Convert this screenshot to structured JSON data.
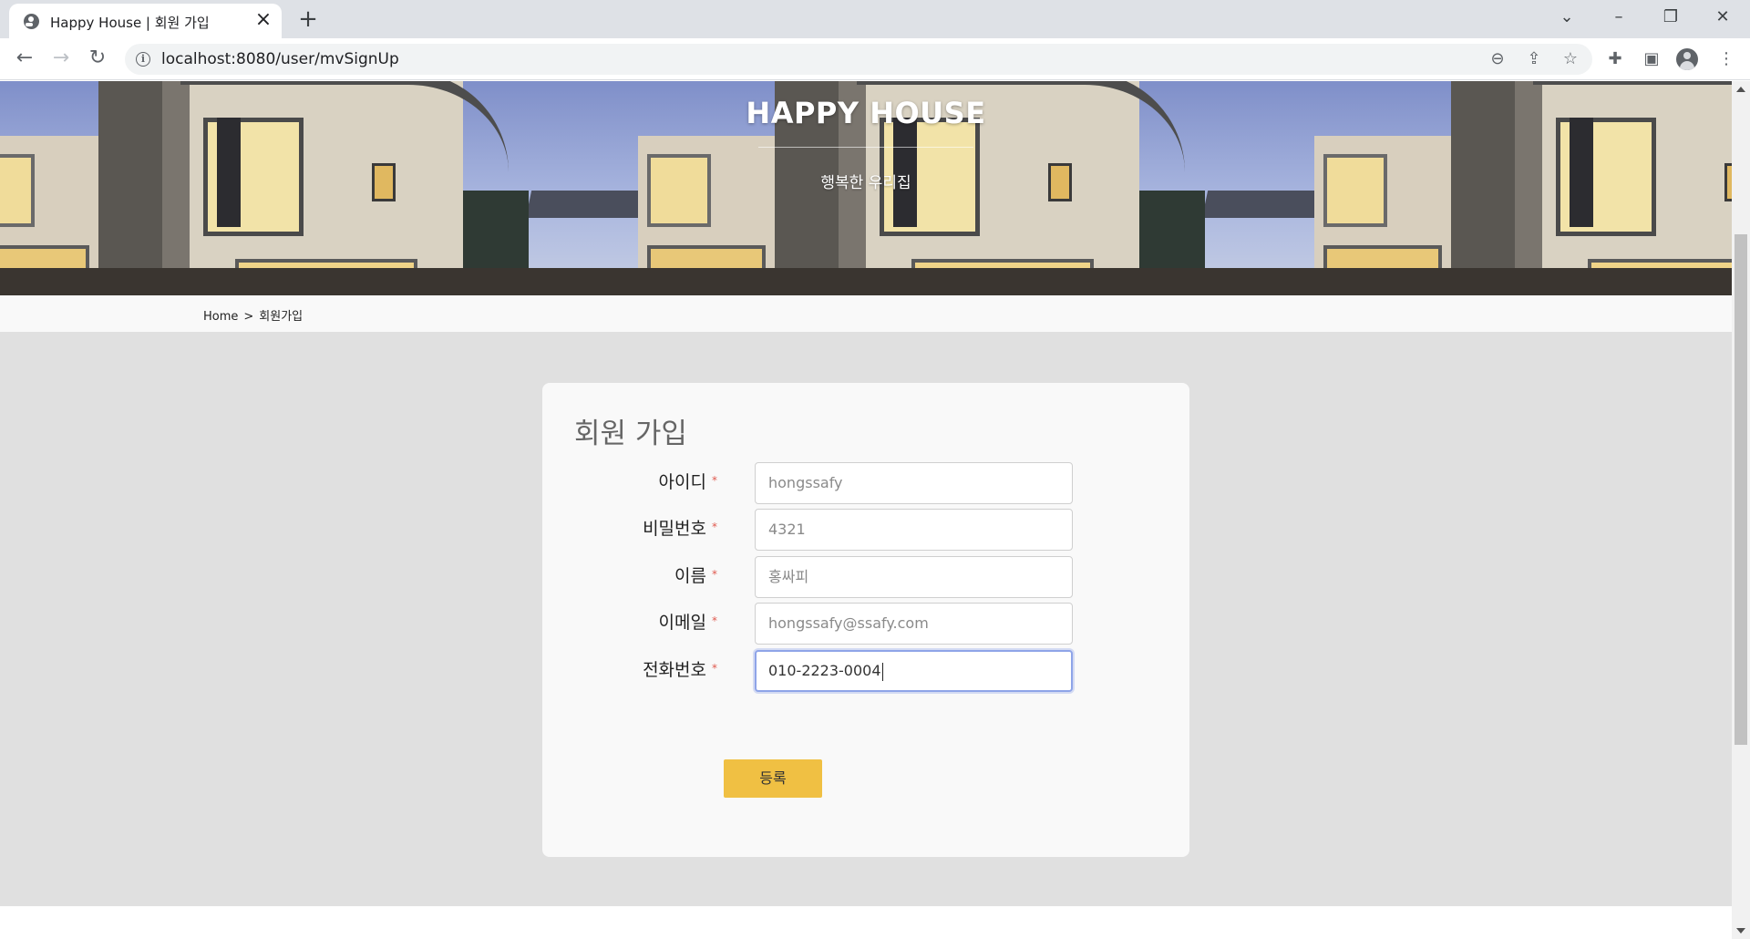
{
  "browser": {
    "tab_title": "Happy House | 회원 가입",
    "url": "localhost:8080/user/mvSignUp",
    "window_controls": [
      "chevron-down-icon",
      "minimize-icon",
      "restore-icon",
      "close-icon"
    ],
    "toolbar_icons": [
      "zoom-out-icon",
      "share-icon",
      "star-icon",
      "extensions-icon",
      "side-panel-icon",
      "profile-avatar-icon",
      "menu-dots-icon"
    ]
  },
  "hero": {
    "title": "HAPPY HOUSE",
    "subtitle": "행복한 우리집"
  },
  "breadcrumb": {
    "home": "Home",
    "separator": ">",
    "current": "회원가입"
  },
  "form": {
    "title": "회원 가입",
    "required_mark": "*",
    "fields": [
      {
        "label": "아이디",
        "value": "hongssafy"
      },
      {
        "label": "비밀번호",
        "value": "4321"
      },
      {
        "label": "이름",
        "value": "홍싸피"
      },
      {
        "label": "이메일",
        "value": "hongssafy@ssafy.com"
      },
      {
        "label": "전화번호",
        "value": "010-2223-0004"
      }
    ],
    "submit_label": "등록"
  },
  "colors": {
    "page_background": "#e0e0e0",
    "card_background": "#f9f9f9",
    "submit_button": "#f0c043",
    "required_mark": "#e05a4f",
    "focus_ring": "#8ea4e8"
  }
}
